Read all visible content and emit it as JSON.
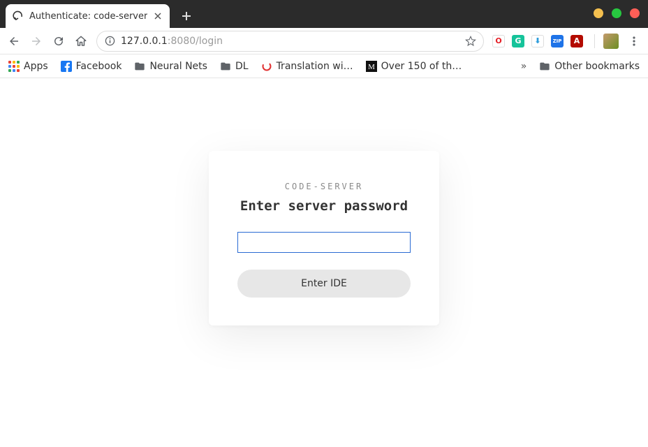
{
  "window": {
    "controls": {
      "min": "#f4bf4f",
      "max": "#27c840",
      "close": "#ff5f57"
    }
  },
  "tab": {
    "title": "Authenticate: code-server"
  },
  "toolbar": {
    "url_host": "127.0.0.1",
    "url_rest": ":8080/login"
  },
  "extensions": [
    {
      "name": "opera-icon",
      "bg": "#ffffff",
      "fg": "#e41e26",
      "glyph": "O"
    },
    {
      "name": "grammarly-icon",
      "bg": "#15c39a",
      "fg": "#ffffff",
      "glyph": "G"
    },
    {
      "name": "idm-icon",
      "bg": "#ffffff",
      "fg": "#2d9cdb",
      "glyph": "⬇"
    },
    {
      "name": "zip-icon",
      "bg": "#1e73e8",
      "fg": "#ffffff",
      "glyph": "ZIP"
    },
    {
      "name": "adobe-icon",
      "bg": "#b30b00",
      "fg": "#ffffff",
      "glyph": "A"
    }
  ],
  "bookmarks": {
    "apps_label": "Apps",
    "items": [
      {
        "type": "fb",
        "label": "Facebook"
      },
      {
        "type": "folder",
        "label": "Neural Nets"
      },
      {
        "type": "folder",
        "label": "DL"
      },
      {
        "type": "spinner",
        "label": "Translation wi…"
      },
      {
        "type": "medium",
        "label": "Over 150 of th…"
      }
    ],
    "other_label": "Other bookmarks"
  },
  "login": {
    "eyebrow": "CODE-SERVER",
    "title": "Enter server password",
    "password_value": "",
    "submit_label": "Enter IDE"
  }
}
